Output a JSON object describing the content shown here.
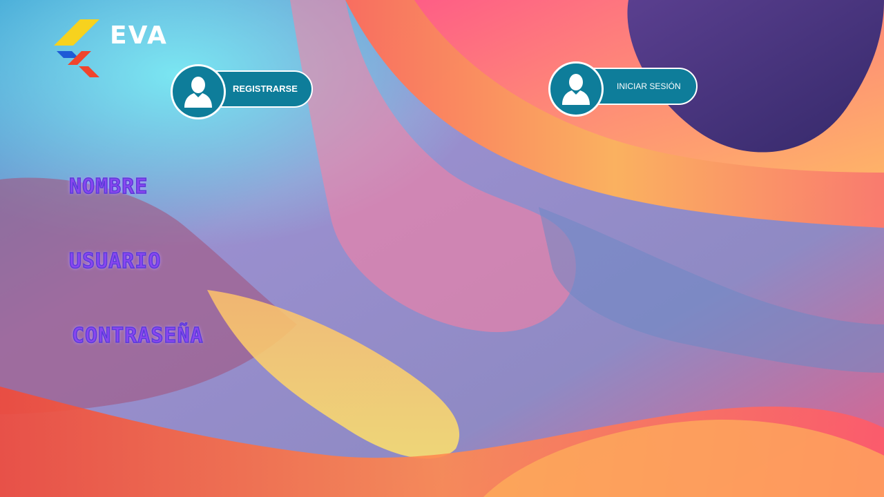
{
  "brand": {
    "name": "EVA",
    "logo_icon": "eva-logo-icon"
  },
  "nav": {
    "register_label": "REGISTRARSE",
    "login_label": "INICIAR SESIÓN",
    "user_icon": "user-icon"
  },
  "form": {
    "name_label": "NOMBRE",
    "user_label": "USUARIO",
    "password_label": "CONTRASEÑA"
  },
  "colors": {
    "button_fill": "#0e7d9a",
    "label_purple": "#8a46f0",
    "logo_yellow": "#f7d21e",
    "logo_blue": "#1e5bd6",
    "logo_red": "#f0452d"
  }
}
